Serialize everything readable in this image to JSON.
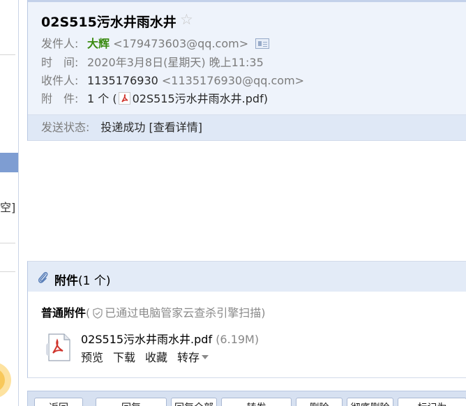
{
  "sidebar": {
    "clipped_text": "空]"
  },
  "mail": {
    "subject": "02S515污水井雨水井",
    "star_icon": "star-outline-icon",
    "from_label": "发件人:",
    "from_name": "大辉",
    "from_email": "<179473603@qq.com>",
    "time_label": "时　间:",
    "time_value": "2020年3月8日(星期天) 晚上11:35",
    "to_label": "收件人:",
    "to_name": "1135176930",
    "to_email": "<1135176930@qq.com>",
    "attach_label": "附　件:",
    "attach_count_prefix": "1 个 (",
    "attach_filename": "02S515污水井雨水井.pdf",
    "attach_count_suffix": ")",
    "status_label": "发送状态:",
    "status_value": "投递成功",
    "status_link": "[查看详情]"
  },
  "attachments": {
    "title": "附件",
    "count": "(1 个)",
    "normal_label": "普通附件",
    "scan_note": "已通过电脑管家云查杀引擎扫描)",
    "scan_open": "(",
    "file_name": "02S515污水井雨水井.pdf",
    "file_size": "(6.19M)",
    "actions": {
      "preview": "预览",
      "download": "下载",
      "favorite": "收藏",
      "save_to": "转存"
    }
  },
  "toolbar": {
    "buttons": [
      "返回",
      "回复",
      "回复全部",
      "转发",
      "删除",
      "彻底删除",
      "标记为"
    ]
  },
  "colors": {
    "accent": "#7e9dd2",
    "header_bg": "#eef3fb",
    "sender_green": "#3a8b10"
  }
}
